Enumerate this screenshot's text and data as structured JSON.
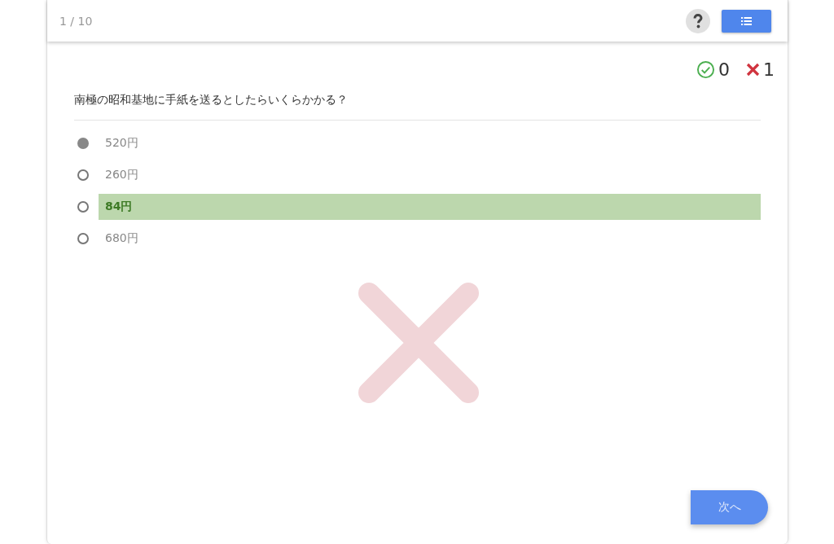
{
  "header": {
    "progress": "1 / 10"
  },
  "score": {
    "correct": "0",
    "wrong": "1"
  },
  "question": "南極の昭和基地に手紙を送るとしたらいくらかかる？",
  "choices": [
    {
      "label": "520円",
      "selected": true,
      "correct": false
    },
    {
      "label": "260円",
      "selected": false,
      "correct": false
    },
    {
      "label": "84円",
      "selected": false,
      "correct": true
    },
    {
      "label": "680円",
      "selected": false,
      "correct": false
    }
  ],
  "answered_correctly": false,
  "next_button": "次へ"
}
